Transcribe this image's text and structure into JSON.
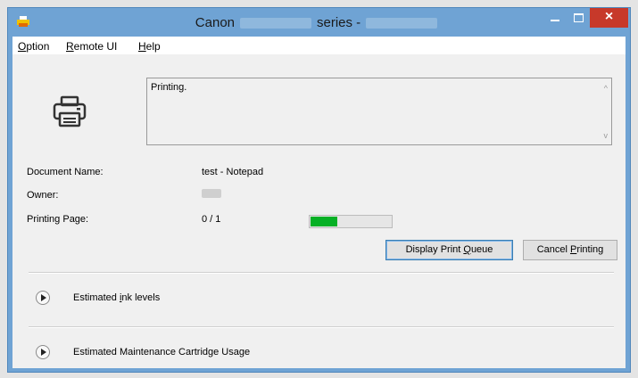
{
  "window": {
    "title_prefix": "Canon",
    "title_suffix": "series -",
    "close_glyph": "×",
    "colors": {
      "titlebar": "#6fa3d4",
      "close": "#c7392a"
    }
  },
  "menu": [
    {
      "hotkey": "O",
      "rest": "ption"
    },
    {
      "hotkey": "R",
      "rest": "emote UI"
    },
    {
      "hotkey": "H",
      "rest": "elp"
    }
  ],
  "status": {
    "icon": "printer-icon",
    "message": "Printing.",
    "scroll_up": "^",
    "scroll_down": "v"
  },
  "job": {
    "document_label": "Document Name:",
    "document_value": "test - Notepad",
    "owner_label": "Owner:",
    "page_label": "Printing Page:",
    "page_value": "0 / 1",
    "progress": 0.33,
    "progress_color": "#06b025"
  },
  "buttons": {
    "queue_pre": "Display Print ",
    "queue_hotkey": "Q",
    "queue_post": "ueue",
    "cancel_pre": "Cancel ",
    "cancel_hotkey": "P",
    "cancel_post": "rinting"
  },
  "sections": [
    {
      "icon": "expand-arrow-icon",
      "pre": "Estimated ",
      "hotkey": "i",
      "post": "nk levels"
    },
    {
      "icon": "expand-arrow-icon",
      "pre": "Estimated Maintenance Cartridge Usage",
      "hotkey": "",
      "post": ""
    }
  ]
}
